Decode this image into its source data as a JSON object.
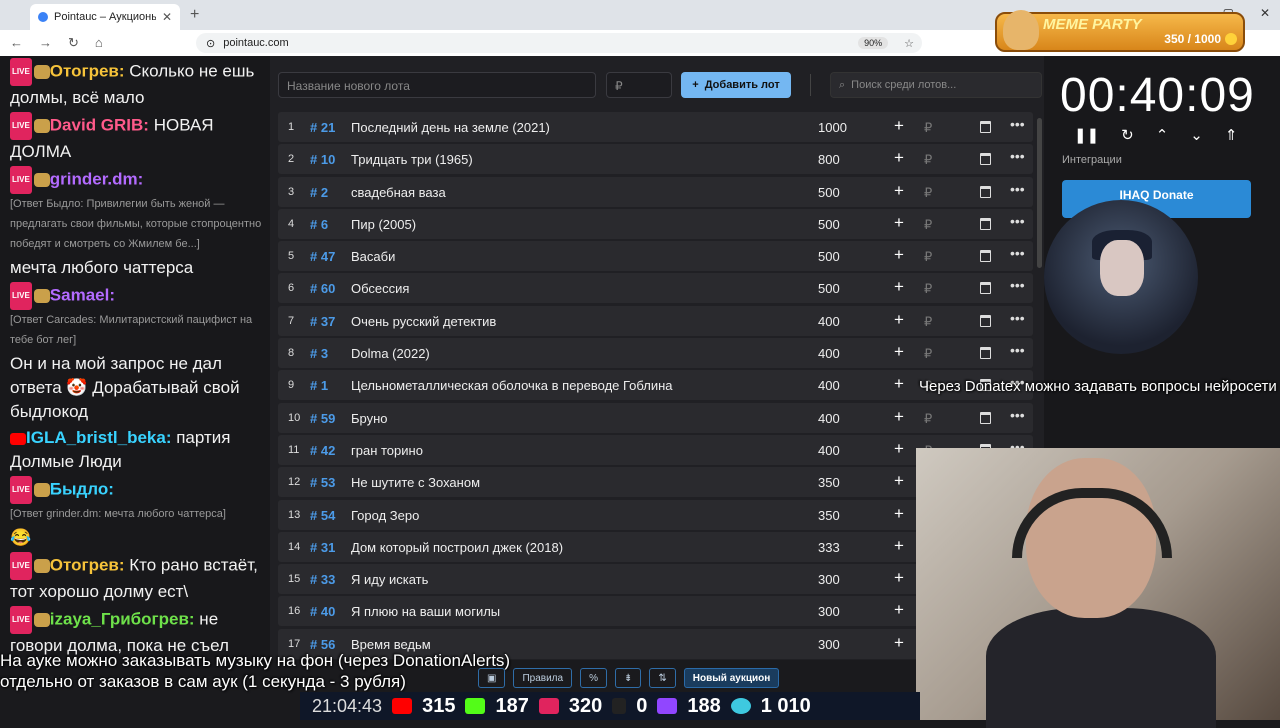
{
  "browser": {
    "tab_title": "Pointauc – Аукционы, лотереи",
    "url": "pointauc.com",
    "zoom": "90%"
  },
  "meme_party": {
    "title": "MEME PARTY",
    "value": "350 / 1000"
  },
  "chat": [
    {
      "nick": "Отогрев:",
      "text": " Сколько не ешь долмы, всё мало",
      "color": "#f6c33a",
      "badge": "live"
    },
    {
      "nick": "David GRIB:",
      "text": " НОВАЯ ДОЛМА",
      "color": "#ff5a8a",
      "badge": "live"
    },
    {
      "nick": "grinder.dm:",
      "text": "",
      "color": "#b36bff",
      "badge": "live"
    },
    {
      "reply": "[Ответ Быдло: Привилегии быть женой — предлагать свои фильмы, которые стопроцентно победят и смотреть со Жмилем бе...]"
    },
    {
      "nick": "",
      "text": "мечта любого чаттерса",
      "color": "#fff",
      "badge": ""
    },
    {
      "nick": "Samael:",
      "text": "",
      "color": "#b36bff",
      "badge": "live"
    },
    {
      "reply": "[Ответ Carcades: Милитаристский пацифист   на тебе бот лег]"
    },
    {
      "nick": "",
      "text": "Он и на мой запрос не дал ответа 🤡 Дорабатывай свой быдлокод",
      "color": "#fff",
      "badge": ""
    },
    {
      "nick": "IGLA_bristl_beka:",
      "text": " партия Долмые Люди",
      "color": "#39d3ff",
      "badge": "yt"
    },
    {
      "nick": "Быдло:",
      "text": "",
      "color": "#39d3ff",
      "badge": "live"
    },
    {
      "reply": "[Ответ grinder.dm: мечта любого чаттерса]"
    },
    {
      "nick": "",
      "text": "😂",
      "color": "#fff",
      "badge": ""
    },
    {
      "nick": "Отогрев:",
      "text": " Кто рано встаёт, тот хорошо долму ест\\",
      "color": "#f6c33a",
      "badge": "live"
    },
    {
      "nick": "izaya_Грибогрев:",
      "text": " не говори долма, пока не съел",
      "color": "#6ee04a",
      "badge": "live"
    }
  ],
  "auction": {
    "new_lot_placeholder": "Название нового лота",
    "amount_placeholder": "₽",
    "add_button": "Добавить лот",
    "search_placeholder": "Поиск среди лотов...",
    "lots": [
      {
        "n": "1",
        "id": "# 21",
        "name": "Последний день на земле (2021)",
        "amount": "1000"
      },
      {
        "n": "2",
        "id": "# 10",
        "name": "Тридцать три (1965)",
        "amount": "800"
      },
      {
        "n": "3",
        "id": "# 2",
        "name": "свадебная ваза",
        "amount": "500"
      },
      {
        "n": "4",
        "id": "# 6",
        "name": "Пир (2005)",
        "amount": "500"
      },
      {
        "n": "5",
        "id": "# 47",
        "name": "Васаби",
        "amount": "500"
      },
      {
        "n": "6",
        "id": "# 60",
        "name": "Обсессия",
        "amount": "500"
      },
      {
        "n": "7",
        "id": "# 37",
        "name": "Очень русский детектив",
        "amount": "400"
      },
      {
        "n": "8",
        "id": "# 3",
        "name": " Dolma (2022)",
        "amount": "400"
      },
      {
        "n": "9",
        "id": "# 1",
        "name": "Цельнометаллическая оболочка в переводе Гоблина",
        "amount": "400"
      },
      {
        "n": "10",
        "id": "# 59",
        "name": "Бруно",
        "amount": "400"
      },
      {
        "n": "11",
        "id": "# 42",
        "name": "гран торино",
        "amount": "400"
      },
      {
        "n": "12",
        "id": "# 53",
        "name": "Не шутите с Зоханом",
        "amount": "350"
      },
      {
        "n": "13",
        "id": "# 54",
        "name": "Город Зеро",
        "amount": "350"
      },
      {
        "n": "14",
        "id": "# 31",
        "name": "Дом который построил джек (2018)",
        "amount": "333"
      },
      {
        "n": "15",
        "id": "# 33",
        "name": "Я иду искать",
        "amount": "300"
      },
      {
        "n": "16",
        "id": "# 40",
        "name": "Я плюю на ваши могилы",
        "amount": "300"
      },
      {
        "n": "17",
        "id": "# 56",
        "name": "Время ведьм",
        "amount": "300"
      }
    ],
    "bottom_rules": "Правила",
    "bottom_percent": "%",
    "bottom_new_auction": "Новый аукцион"
  },
  "timer": {
    "value": "00:40:09",
    "integrations": "Интеграции",
    "ihaq": "IHAQ Donate"
  },
  "overlay": {
    "donatex": "Через Donatex можно задавать вопросы нейросети",
    "music_line1": "На ауке можно заказывать музыку на фон (через DonationAlerts)",
    "music_line2": "отдельно от заказов в сам аук (1 секунда - 3 рубля)"
  },
  "stats": {
    "clock": "21:04:43",
    "youtube": "315",
    "kick": "187",
    "live": "320",
    "r": "0",
    "twitch": "188",
    "viewers": "1 010"
  }
}
